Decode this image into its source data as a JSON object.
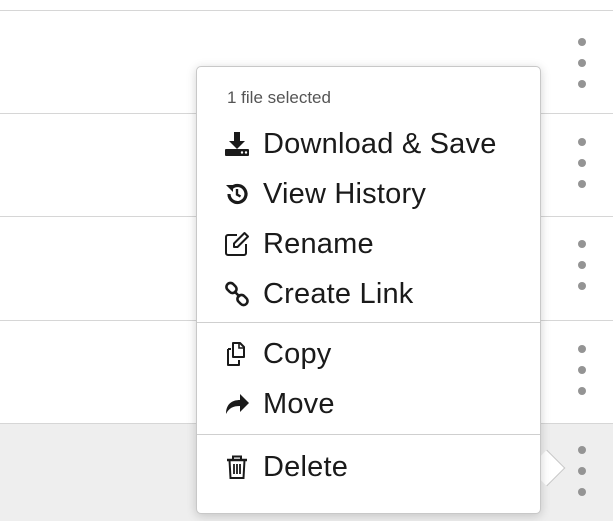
{
  "file_list": {
    "rows": [
      {
        "id": "row-1",
        "selected": false
      },
      {
        "id": "row-2",
        "selected": false
      },
      {
        "id": "row-3",
        "selected": false
      },
      {
        "id": "row-4",
        "selected": false
      },
      {
        "id": "row-5",
        "selected": true
      }
    ]
  },
  "context_menu": {
    "header": "1 file selected",
    "items": [
      {
        "label": "Download & Save",
        "icon": "download-icon"
      },
      {
        "label": "View History",
        "icon": "history-icon"
      },
      {
        "label": "Rename",
        "icon": "edit-icon"
      },
      {
        "label": "Create Link",
        "icon": "link-icon"
      },
      {
        "label": "Copy",
        "icon": "copy-icon"
      },
      {
        "label": "Move",
        "icon": "move-arrow-icon"
      },
      {
        "label": "Delete",
        "icon": "trash-icon"
      }
    ]
  },
  "colors": {
    "selected_row": "#eeeeee",
    "divider": "#d6d6d6",
    "kebab_dot": "#949494",
    "menu_text": "#1a1a1a",
    "header_text": "#555555"
  }
}
